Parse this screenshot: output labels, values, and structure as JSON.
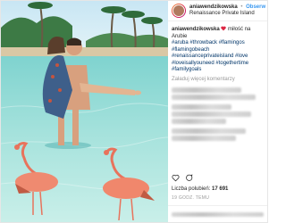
{
  "post": {
    "username": "aniawendzikowska",
    "location": "Renaissance Private Island",
    "follow_label": "Obserw",
    "separator": "•",
    "caption_text": " miłość na Arubie",
    "hashtags": "#aruba #throwback #flamingos #flamingobeach #renaissanceprivateisland #love #loveisallyouneed #togethertime #familygoals",
    "more_comments_label": "Załaduj więcej komentarzy",
    "likes_label": "Liczba polubień:",
    "likes_count": "17 691",
    "date_label": "19 GODZ. TEMU"
  },
  "icons": [
    "heart-icon",
    "comment-icon"
  ],
  "colors": {
    "link": "#003569",
    "follow": "#3897f0",
    "muted": "#999999",
    "accent": "#dc2743"
  }
}
